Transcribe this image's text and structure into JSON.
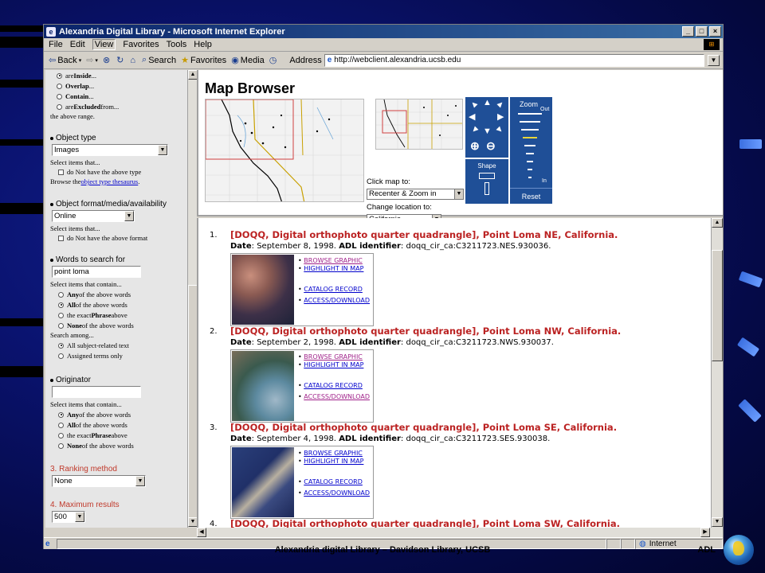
{
  "window": {
    "title": "Alexandria Digital Library - Microsoft Internet Explorer",
    "controls": [
      "_",
      "□",
      "×"
    ]
  },
  "menu": [
    "File",
    "Edit",
    "View",
    "Favorites",
    "Tools",
    "Help"
  ],
  "toolbar": {
    "back": "Back",
    "search": "Search",
    "favorites": "Favorites",
    "media": "Media",
    "address_label": "Address",
    "url": "http://webclient.alexandria.ucsb.edu"
  },
  "left": {
    "range_options": [
      {
        "prefix": "are ",
        "bold": "Inside",
        "suffix": "...",
        "selected": true
      },
      {
        "prefix": "",
        "bold": "Overlap",
        "suffix": "...",
        "selected": false
      },
      {
        "prefix": "",
        "bold": "Contain",
        "suffix": "...",
        "selected": false
      },
      {
        "prefix": "are ",
        "bold": "Excluded",
        "suffix": " from...",
        "selected": false
      }
    ],
    "range_note": "the above range.",
    "object_type": {
      "heading": "Object type",
      "value": "Images",
      "hint": "Select items that...",
      "negate": "do Not have the above type",
      "browse_prefix": "Browse the ",
      "browse_link": "object type thesaurus",
      "browse_suffix": "."
    },
    "object_format": {
      "heading": "Object format/media/availability",
      "value": "Online",
      "hint": "Select items that...",
      "negate": "do Not have the above format"
    },
    "words": {
      "heading": "Words to search for",
      "value": "point loma",
      "hint": "Select items that contain...",
      "options": [
        {
          "bold": "Any",
          "text": " of the above words",
          "selected": false
        },
        {
          "bold": "All",
          "text": " of the above words",
          "selected": true
        },
        {
          "bold": "Phrase",
          "text": " above",
          "pre": "the exact ",
          "selected": false
        },
        {
          "bold": "None",
          "text": " of the above words",
          "selected": false
        }
      ],
      "search_among": "Search among...",
      "among_options": [
        {
          "text": "All subject-related text",
          "selected": true
        },
        {
          "text": "Assigned terms only",
          "selected": false
        }
      ]
    },
    "originator": {
      "heading": "Originator",
      "value": "",
      "hint": "Select items that contain...",
      "options": [
        {
          "bold": "Any",
          "text": " of the above words",
          "selected": true
        },
        {
          "bold": "All",
          "text": " of the above words",
          "selected": false
        },
        {
          "bold": "Phrase",
          "text": " above",
          "pre": "the exact ",
          "selected": false
        },
        {
          "bold": "None",
          "text": " of the above words",
          "selected": false
        }
      ]
    },
    "ranking": {
      "heading": "3. Ranking method",
      "value": "None"
    },
    "max_results": {
      "heading": "4. Maximum results",
      "value": "500"
    }
  },
  "map_browser": {
    "title": "Map Browser",
    "click_label": "Click map to:",
    "click_value": "Recenter & Zoom in",
    "change_label": "Change location to:",
    "change_value": "California",
    "zoom_label": "Zoom",
    "zoom_out": "Out",
    "zoom_in": "In",
    "shape_label": "Shape",
    "reset_label": "Reset"
  },
  "results": [
    {
      "num": "1.",
      "title": "[DOQQ, Digital orthophoto quarter quadrangle], Point Loma NE, California.",
      "date": "September 8, 1998.",
      "adl_id": "doqq_cir_ca:C3211723.NES.930036."
    },
    {
      "num": "2.",
      "title": "[DOQQ, Digital orthophoto quarter quadrangle], Point Loma NW, California.",
      "date": "September 2, 1998.",
      "adl_id": "doqq_cir_ca:C3211723.NWS.930037."
    },
    {
      "num": "3.",
      "title": "[DOQQ, Digital orthophoto quarter quadrangle], Point Loma SE, California.",
      "date": "September 4, 1998.",
      "adl_id": "doqq_cir_ca:C3211723.SES.930038."
    },
    {
      "num": "4.",
      "title": "[DOQQ, Digital orthophoto quarter quadrangle], Point Loma SW, California.",
      "date": "",
      "adl_id": ""
    }
  ],
  "result_labels": {
    "date": "Date",
    "adl": "ADL identifier",
    "links": [
      "BROWSE GRAPHIC",
      "HIGHLIGHT IN MAP",
      "CATALOG RECORD",
      "ACCESS/DOWNLOAD"
    ]
  },
  "status": {
    "zone": "Internet"
  },
  "footer": {
    "caption": "Alexandria digital Library – Davidson Library, UCSB",
    "brand": "ADL"
  }
}
